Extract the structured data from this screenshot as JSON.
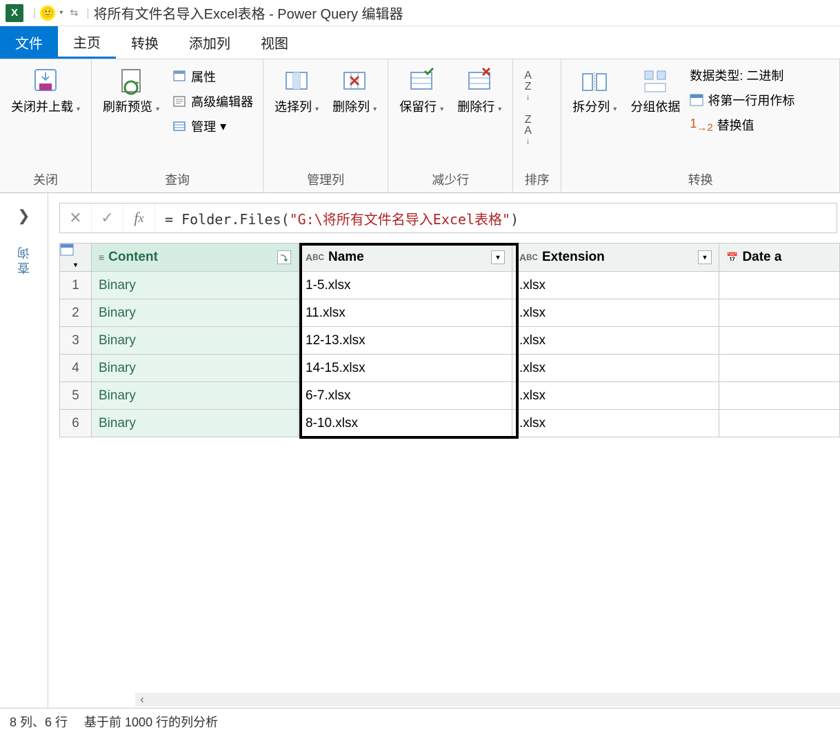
{
  "titlebar": {
    "app_icon_letter": "X",
    "title": "将所有文件名导入Excel表格 - Power Query 编辑器"
  },
  "tabs": {
    "file": "文件",
    "home": "主页",
    "transform": "转换",
    "add_column": "添加列",
    "view": "视图"
  },
  "ribbon": {
    "close_load": {
      "label": "关闭并上载",
      "group": "关闭"
    },
    "refresh": {
      "label": "刷新预览"
    },
    "properties": "属性",
    "advanced_editor": "高级编辑器",
    "manage": "管理",
    "query_group": "查询",
    "choose_cols": "选择列",
    "remove_cols": "删除列",
    "manage_cols_group": "管理列",
    "keep_rows": "保留行",
    "remove_rows": "删除行",
    "reduce_rows_group": "减少行",
    "sort_group": "排序",
    "split_col": "拆分列",
    "group_by": "分组依据",
    "data_type": "数据类型: 二进制",
    "first_row_header": "将第一行用作标",
    "replace_values": "替换值",
    "transform_group": "转换"
  },
  "side": {
    "queries": "查询"
  },
  "formula": {
    "prefix": "= ",
    "fn": "Folder.Files",
    "open": "(",
    "str": "\"G:\\将所有文件名导入Excel表格\"",
    "close": ")"
  },
  "columns": {
    "content": "Content",
    "name": "Name",
    "extension": "Extension",
    "date": "Date a"
  },
  "rows": [
    {
      "n": "1",
      "content": "Binary",
      "name": "1-5.xlsx",
      "ext": ".xlsx"
    },
    {
      "n": "2",
      "content": "Binary",
      "name": "11.xlsx",
      "ext": ".xlsx"
    },
    {
      "n": "3",
      "content": "Binary",
      "name": "12-13.xlsx",
      "ext": ".xlsx"
    },
    {
      "n": "4",
      "content": "Binary",
      "name": "14-15.xlsx",
      "ext": ".xlsx"
    },
    {
      "n": "5",
      "content": "Binary",
      "name": "6-7.xlsx",
      "ext": ".xlsx"
    },
    {
      "n": "6",
      "content": "Binary",
      "name": "8-10.xlsx",
      "ext": ".xlsx"
    }
  ],
  "status": {
    "cols_rows": "8 列、6 行",
    "profiling": "基于前 1000 行的列分析"
  }
}
